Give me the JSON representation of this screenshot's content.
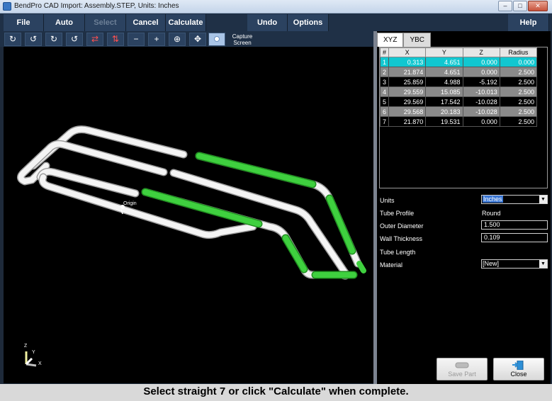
{
  "window": {
    "title": "BendPro CAD Import: Assembly.STEP, Units: Inches",
    "minimize": "–",
    "maximize": "□",
    "close": "✕"
  },
  "menu": {
    "file": "File",
    "auto": "Auto",
    "select": "Select",
    "cancel": "Cancel",
    "calculate": "Calculate",
    "undo": "Undo",
    "options": "Options",
    "help": "Help"
  },
  "toolbar": {
    "capture_line1": "Capture",
    "capture_line2": "Screen",
    "icons": [
      "rotate-ccw-icon",
      "rotate-cw-icon",
      "roll-ccw-icon",
      "roll-cw-icon",
      "flip-horizontal-icon",
      "flip-vertical-icon",
      "zoom-out-icon",
      "zoom-in-icon",
      "zoom-fit-icon",
      "pan-icon",
      "view-dot-icon"
    ],
    "glyphs": [
      "↻",
      "↺",
      "↻",
      "↺",
      "⇄",
      "⇅",
      "−",
      "+",
      "⊕",
      "✥"
    ]
  },
  "viewport": {
    "origin_label": "Origin",
    "axis_z": "Z",
    "axis_y": "Y",
    "axis_x": "X",
    "tube_color": "#ffffff",
    "selected_color": "#33cc33"
  },
  "tabs": {
    "xyz": "XYZ",
    "ybc": "YBC"
  },
  "table": {
    "headers": [
      "#",
      "X",
      "Y",
      "Z",
      "Radius"
    ],
    "rows": [
      [
        "1",
        "0.313",
        "4.651",
        "0.000",
        "0.000"
      ],
      [
        "2",
        "21.874",
        "4.651",
        "0.000",
        "2.500"
      ],
      [
        "3",
        "25.859",
        "4.988",
        "-5.192",
        "2.500"
      ],
      [
        "4",
        "29.559",
        "15.085",
        "-10.013",
        "2.500"
      ],
      [
        "5",
        "29.569",
        "17.542",
        "-10.028",
        "2.500"
      ],
      [
        "6",
        "29.568",
        "20.183",
        "-10.028",
        "2.500"
      ],
      [
        "7",
        "21.870",
        "19.531",
        "0.000",
        "2.500"
      ]
    ],
    "selected_row": 0
  },
  "properties": {
    "units_label": "Units",
    "units_value": "Inches",
    "tube_profile_label": "Tube Profile",
    "tube_profile_value": "Round",
    "outer_diameter_label": "Outer Diameter",
    "outer_diameter_value": "1.500",
    "wall_thickness_label": "Wall Thickness",
    "wall_thickness_value": "0.109",
    "tube_length_label": "Tube Length",
    "material_label": "Material",
    "material_value": "[New]"
  },
  "actions": {
    "save_part": "Save Part",
    "close": "Close"
  },
  "status": {
    "message": "Select straight 7 or click \"Calculate\" when complete."
  },
  "colors": {
    "selected_row": "#11c7d0",
    "alt_row": "#8a8a8a",
    "menu_bg": "#2b4260"
  }
}
